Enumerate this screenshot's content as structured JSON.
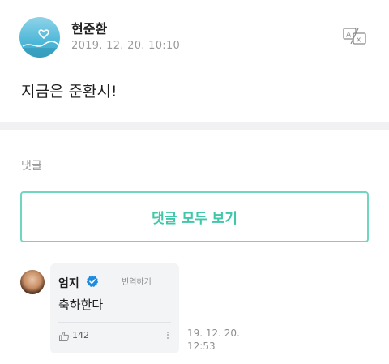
{
  "post": {
    "author": "현준환",
    "timestamp": "2019. 12. 20. 10:10",
    "body": "지금은 준환시!",
    "translate_icon": "translate-icon"
  },
  "comments": {
    "section_label": "댓글",
    "view_all_label": "댓글 모두 보기",
    "items": [
      {
        "author": "엄지",
        "verified": true,
        "translate_label": "번역하기",
        "text": "축하한다",
        "likes": "142",
        "time_line1": "19. 12. 20.",
        "time_line2": "12:53"
      }
    ]
  },
  "colors": {
    "accent": "#3fc7a9",
    "accent_border": "#6fd6c0",
    "verified": "#1d8ce0",
    "muted": "#9a9a9a",
    "bubble_bg": "#f3f4f6"
  }
}
